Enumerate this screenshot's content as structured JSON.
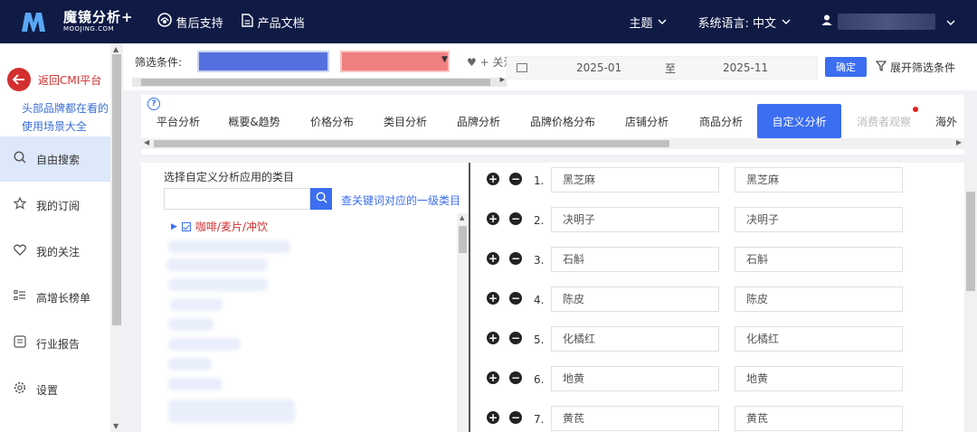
{
  "header": {
    "brand_name": "魔镜分析+",
    "brand_domain": "MOOJING.COM",
    "links": [
      {
        "label": "售后支持",
        "icon": "headset-icon"
      },
      {
        "label": "产品文档",
        "icon": "document-icon"
      }
    ],
    "theme_label": "主题",
    "language_label": "系统语言: 中文",
    "user_icon": "user-icon"
  },
  "sidebar": {
    "back_label": "返回CMI平台",
    "promo_text": "头部品牌都在看的使用场景大全",
    "items": [
      {
        "label": "自由搜索",
        "icon": "search-icon",
        "active": true
      },
      {
        "label": "我的订阅",
        "icon": "star-icon",
        "active": false
      },
      {
        "label": "我的关注",
        "icon": "heart-icon",
        "active": false
      },
      {
        "label": "高增长榜单",
        "icon": "list-icon",
        "active": false
      },
      {
        "label": "行业报告",
        "icon": "report-icon",
        "active": false
      },
      {
        "label": "设置",
        "icon": "gear-icon",
        "active": false
      }
    ]
  },
  "filter": {
    "label": "筛选条件:",
    "follow_label": "+ 关注",
    "date_start": "2025-01",
    "date_to": "至",
    "date_end": "2025-11",
    "confirm_label": "确定",
    "expand_label": "展开筛选条件"
  },
  "tabs": [
    {
      "label": "平台分析",
      "state": "normal"
    },
    {
      "label": "概要&趋势",
      "state": "normal"
    },
    {
      "label": "价格分布",
      "state": "normal"
    },
    {
      "label": "类目分析",
      "state": "normal"
    },
    {
      "label": "品牌分析",
      "state": "normal"
    },
    {
      "label": "品牌价格分布",
      "state": "normal"
    },
    {
      "label": "店铺分析",
      "state": "normal"
    },
    {
      "label": "商品分析",
      "state": "normal"
    },
    {
      "label": "自定义分析",
      "state": "active"
    },
    {
      "label": "消费者观察",
      "state": "dim"
    },
    {
      "label": "海外",
      "state": "normal"
    }
  ],
  "category_panel": {
    "title": "选择自定义分析应用的类目",
    "search_placeholder": "",
    "keyword_link": "查关键词对应的一级类目",
    "tree_first": "咖啡/麦片/冲饮"
  },
  "custom_rows": [
    {
      "num": "1.",
      "keyword": "黑芝麻",
      "alias": "黑芝麻"
    },
    {
      "num": "2.",
      "keyword": "决明子",
      "alias": "决明子"
    },
    {
      "num": "3.",
      "keyword": "石斛",
      "alias": "石斛"
    },
    {
      "num": "4.",
      "keyword": "陈皮",
      "alias": "陈皮"
    },
    {
      "num": "5.",
      "keyword": "化橘红",
      "alias": "化橘红"
    },
    {
      "num": "6.",
      "keyword": "地黄",
      "alias": "地黄"
    },
    {
      "num": "7.",
      "keyword": "黄芪",
      "alias": "黄芪"
    }
  ],
  "colors": {
    "topbar": "#0f1b45",
    "accent": "#3b6ef0",
    "back_red": "#d32f2f"
  }
}
